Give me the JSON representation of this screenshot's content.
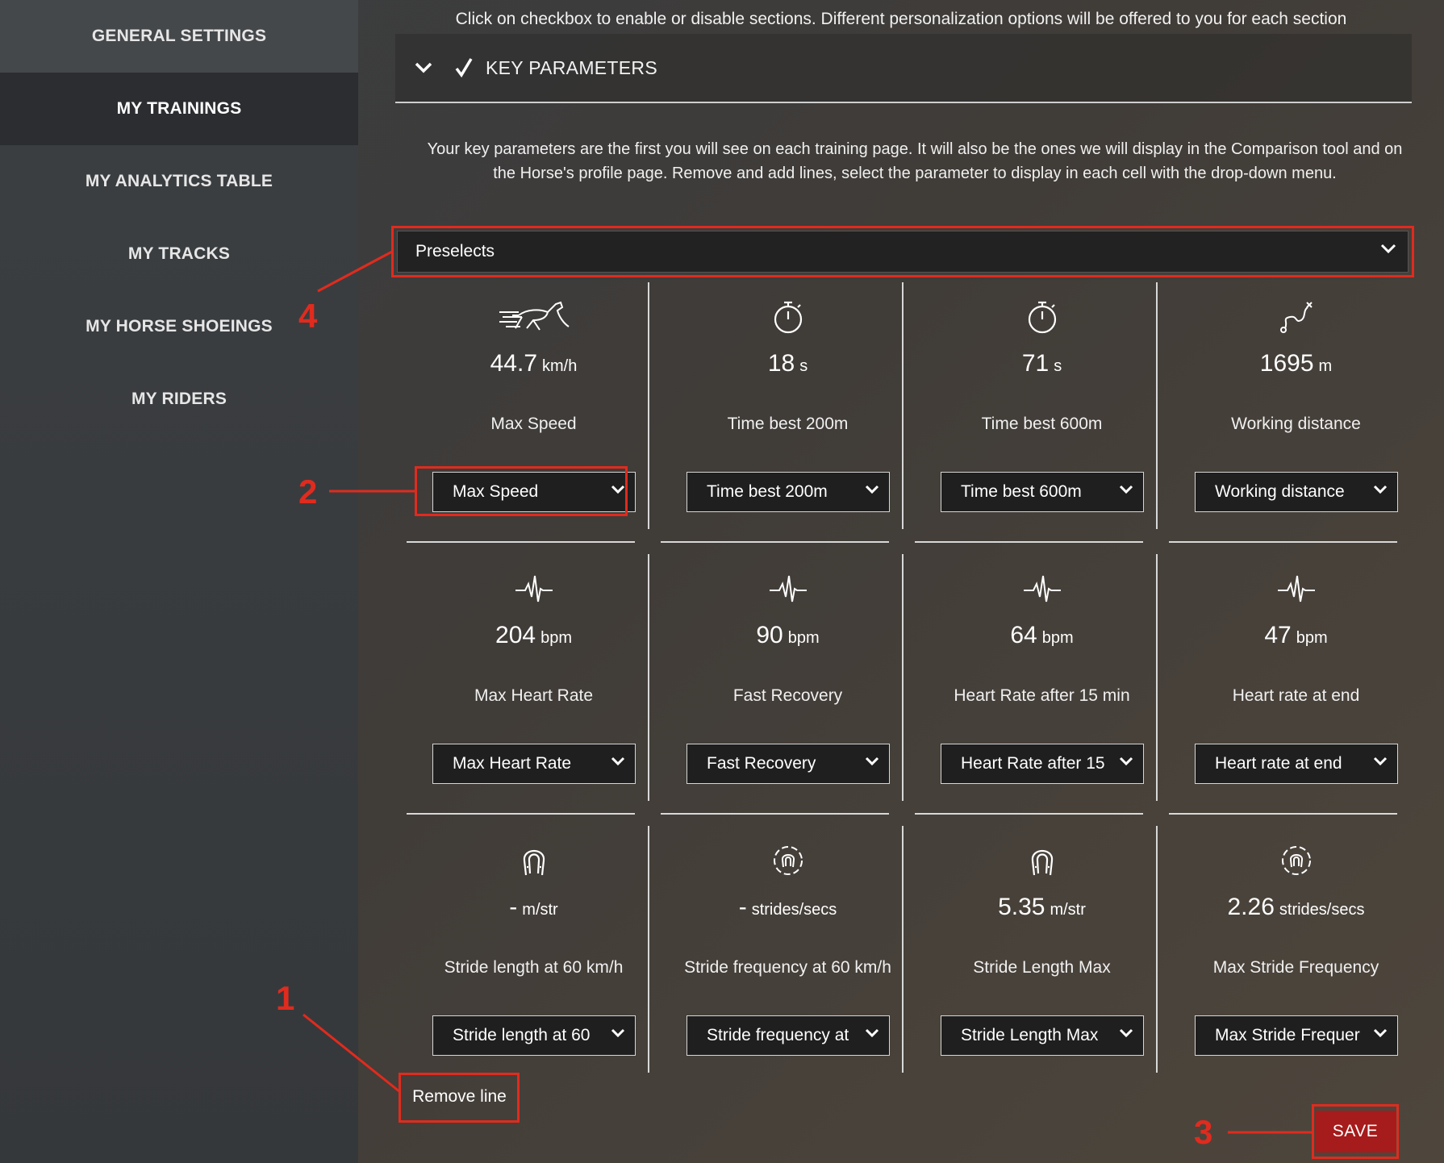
{
  "sidebar": {
    "items": [
      {
        "label": "GENERAL SETTINGS"
      },
      {
        "label": "MY TRAININGS"
      },
      {
        "label": "MY ANALYTICS TABLE"
      },
      {
        "label": "MY TRACKS"
      },
      {
        "label": "MY HORSE SHOEINGS"
      },
      {
        "label": "MY RIDERS"
      }
    ],
    "active_index": 1
  },
  "main": {
    "top_hint": "Click on checkbox to enable or disable sections. Different personalization options will be offered to you for each section",
    "section": {
      "title": "KEY PARAMETERS",
      "checked": true
    },
    "intro": "Your key parameters are the first you will see on each training page. It will also be the ones we will display in the Comparison tool and on the Horse's profile page. Remove and add lines, select the parameter to display in each cell with the drop-down menu.",
    "preselect": {
      "value": "Preselects"
    },
    "rows": [
      [
        {
          "icon": "galloping-horse-icon",
          "value": "44.7",
          "unit": "km/h",
          "label": "Max Speed",
          "select": "Max Speed"
        },
        {
          "icon": "stopwatch-icon",
          "value": "18",
          "unit": "s",
          "label": "Time best 200m",
          "select": "Time best 200m"
        },
        {
          "icon": "stopwatch-icon",
          "value": "71",
          "unit": "s",
          "label": "Time best 600m",
          "select": "Time best 600m"
        },
        {
          "icon": "distance-path-icon",
          "value": "1695",
          "unit": "m",
          "label": "Working distance",
          "select": "Working distance"
        }
      ],
      [
        {
          "icon": "heartbeat-icon",
          "value": "204",
          "unit": "bpm",
          "label": "Max Heart Rate",
          "select": "Max Heart Rate"
        },
        {
          "icon": "heartbeat-icon",
          "value": "90",
          "unit": "bpm",
          "label": "Fast Recovery",
          "select": "Fast Recovery"
        },
        {
          "icon": "heartbeat-icon",
          "value": "64",
          "unit": "bpm",
          "label": "Heart Rate after 15 min",
          "select": "Heart Rate after 15"
        },
        {
          "icon": "heartbeat-icon",
          "value": "47",
          "unit": "bpm",
          "label": "Heart rate at end",
          "select": "Heart rate at end"
        }
      ],
      [
        {
          "icon": "horseshoe-icon",
          "value": "-",
          "unit": "m/str",
          "label": "Stride length at 60 km/h",
          "select": "Stride length at 60"
        },
        {
          "icon": "horseshoe-cycle-icon",
          "value": "-",
          "unit": "strides/secs",
          "label": "Stride frequency at 60 km/h",
          "select": "Stride frequency at"
        },
        {
          "icon": "horseshoe-icon",
          "value": "5.35",
          "unit": "m/str",
          "label": "Stride Length Max",
          "select": "Stride Length Max"
        },
        {
          "icon": "horseshoe-cycle-icon",
          "value": "2.26",
          "unit": "strides/secs",
          "label": "Max Stride Frequency",
          "select": "Max Stride Frequer"
        }
      ]
    ],
    "remove_line_label": "Remove line",
    "save_label": "SAVE"
  },
  "annotations": {
    "color": "#e02b1e",
    "numbers": [
      "1",
      "2",
      "3",
      "4"
    ]
  }
}
